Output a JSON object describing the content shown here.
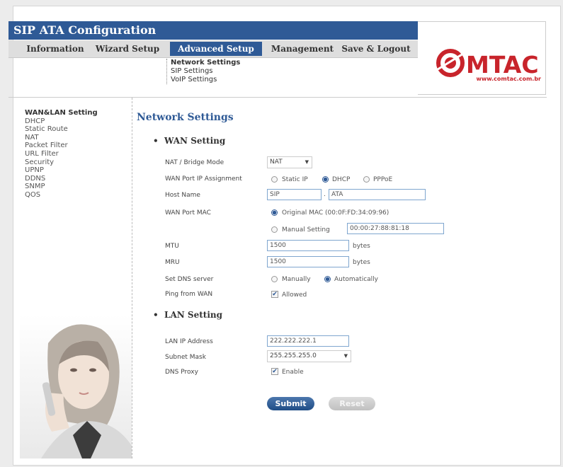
{
  "header": {
    "title": "SIP ATA Configuration",
    "nav": [
      "Information",
      "Wizard Setup",
      "Advanced Setup",
      "Management",
      "Save & Logout"
    ],
    "active_nav": "Advanced Setup",
    "subnav": [
      "Network Settings",
      "SIP Settings",
      "VoIP Settings"
    ],
    "logo_text": "C MTAC",
    "logo_url": "www.comtac.com.br",
    "brand_color": "#2f5a96",
    "logo_color": "#c8242b"
  },
  "sidebar": {
    "items": [
      "WAN&LAN Setting",
      "DHCP",
      "Static Route",
      "NAT",
      "Packet Filter",
      "URL Filter",
      "Security",
      "UPNP",
      "DDNS",
      "SNMP",
      "QOS"
    ]
  },
  "page": {
    "title": "Network Settings"
  },
  "wan": {
    "heading": "WAN Setting",
    "nat_label": "NAT / Bridge Mode",
    "nat_value": "NAT",
    "ip_assign_label": "WAN Port IP Assignment",
    "opt_static": "Static IP",
    "opt_dhcp": "DHCP",
    "opt_pppoe": "PPPoE",
    "hostname_label": "Host Name",
    "hostname_1": "SIP",
    "hostname_sep": ".",
    "hostname_2": "ATA",
    "mac_label": "WAN Port MAC",
    "mac_original": "Original MAC (00:0F:FD:34:09:96)",
    "mac_manual": "Manual Setting",
    "mac_manual_value": "00:00:27:88:81:18",
    "mtu_label": "MTU",
    "mtu_value": "1500",
    "mru_label": "MRU",
    "mru_value": "1500",
    "unit_bytes": "bytes",
    "dns_label": "Set DNS server",
    "dns_manual": "Manually",
    "dns_auto": "Automatically",
    "ping_label": "Ping from WAN",
    "ping_opt": "Allowed"
  },
  "lan": {
    "heading": "LAN Setting",
    "ip_label": "LAN IP Address",
    "ip_value": "222.222.222.1",
    "mask_label": "Subnet Mask",
    "mask_value": "255.255.255.0",
    "dns_proxy_label": "DNS Proxy",
    "dns_proxy_opt": "Enable"
  },
  "buttons": {
    "submit": "Submit",
    "reset": "Reset"
  },
  "icons": {
    "bullet": "bullet-icon",
    "dropdown": "chevron-down-icon",
    "check": "checkmark-icon"
  }
}
